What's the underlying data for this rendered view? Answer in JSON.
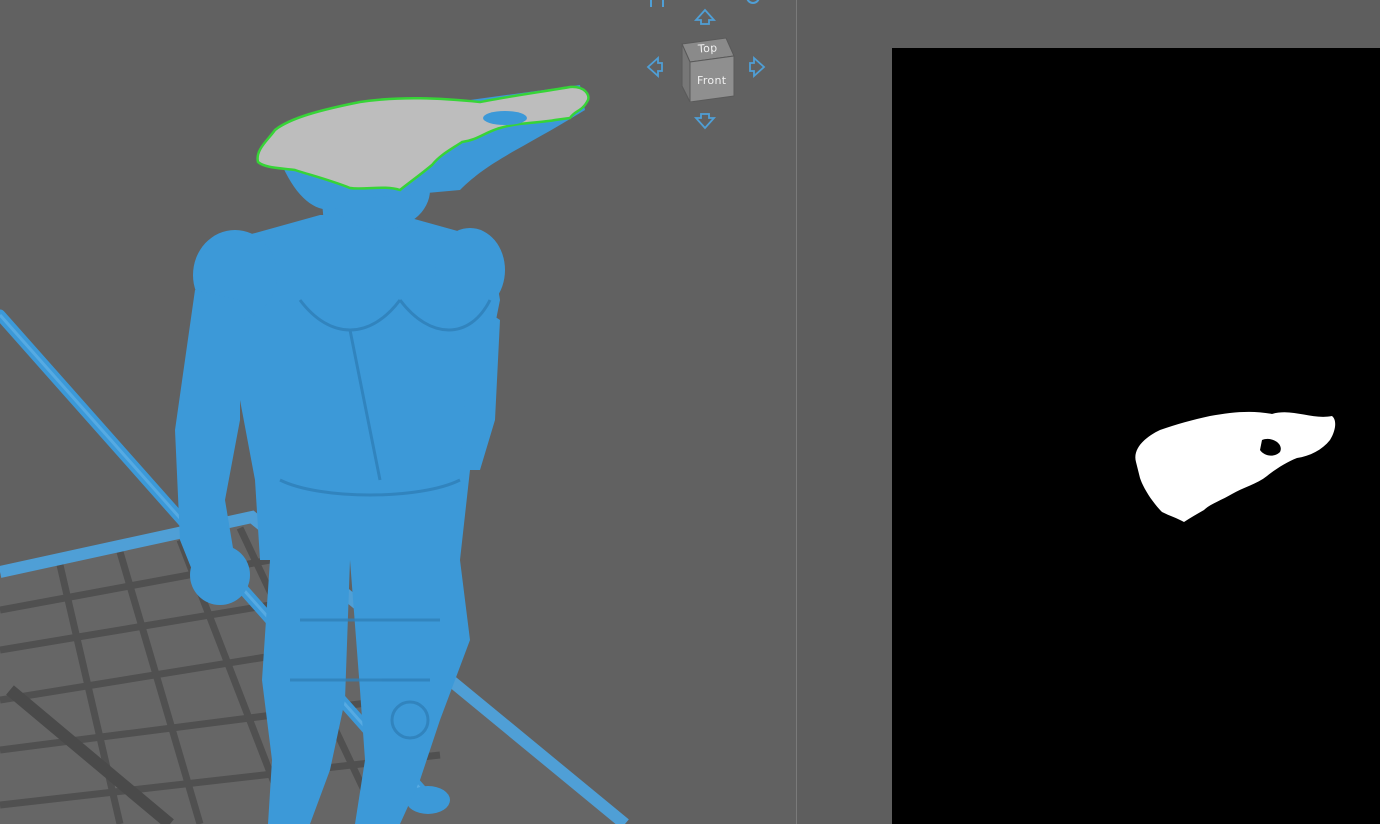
{
  "navcube": {
    "top_label": "Top",
    "front_label": "Front",
    "icons": {
      "home": "home-icon",
      "settings": "rotate-icon",
      "up": "arrow-up-icon",
      "down": "arrow-down-icon",
      "left": "arrow-left-icon",
      "right": "arrow-right-icon"
    }
  },
  "colors": {
    "model": "#3c99d8",
    "build_plate": "#4f9fd6",
    "slice_cross_section": "#bdbdbd",
    "slice_outline": "#37d437",
    "background": "#616161",
    "slice_preview_bg": "#000000",
    "slice_preview_fg": "#ffffff"
  }
}
